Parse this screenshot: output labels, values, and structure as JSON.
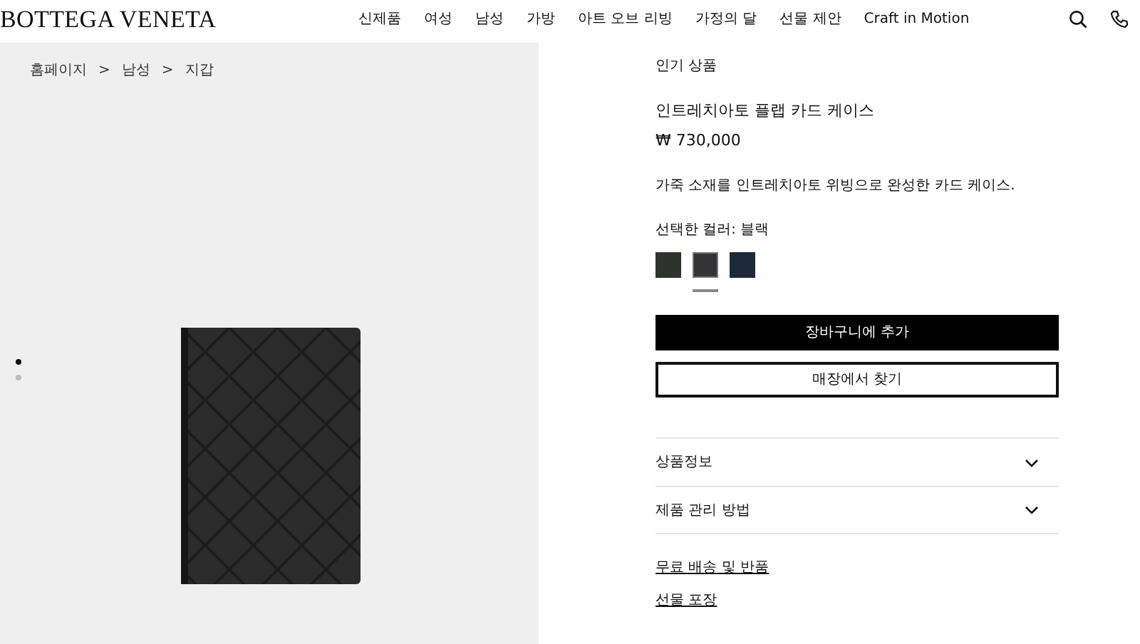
{
  "header": {
    "logo": "BOTTEGA VENETA",
    "nav": [
      "신제품",
      "여성",
      "남성",
      "가방",
      "아트 오브 리빙",
      "가정의 달",
      "선물 제안",
      "Craft in Motion"
    ]
  },
  "breadcrumb": [
    "홈페이지",
    ">",
    "남성",
    ">",
    "지갑"
  ],
  "gallery": {
    "dots": [
      {
        "selected": true
      },
      {
        "selected": false
      }
    ]
  },
  "product": {
    "tag": "인기 상품",
    "title": "인트레치아토 플랩 카드 케이스",
    "price": "₩ 730,000",
    "description": "가죽 소재를 인트레치아토 위빙으로 완성한 카드 케이스.",
    "color_label": "선택한 컬러: 블랙",
    "swatches": [
      {
        "color": "#2f332e",
        "selected": false
      },
      {
        "color": "#343436",
        "selected": true
      },
      {
        "color": "#1e2a3a",
        "selected": false
      }
    ],
    "buttons": [
      {
        "kind": "primary",
        "label": "장바구니에 추가"
      },
      {
        "kind": "outline",
        "label": "매장에서 찾기"
      }
    ],
    "accordion": [
      {
        "label": "상품정보",
        "expanded": false
      },
      {
        "label": "제품 관리 방법",
        "expanded": false
      }
    ],
    "links": [
      "무료 배송 및 반품",
      "선물 포장"
    ]
  }
}
